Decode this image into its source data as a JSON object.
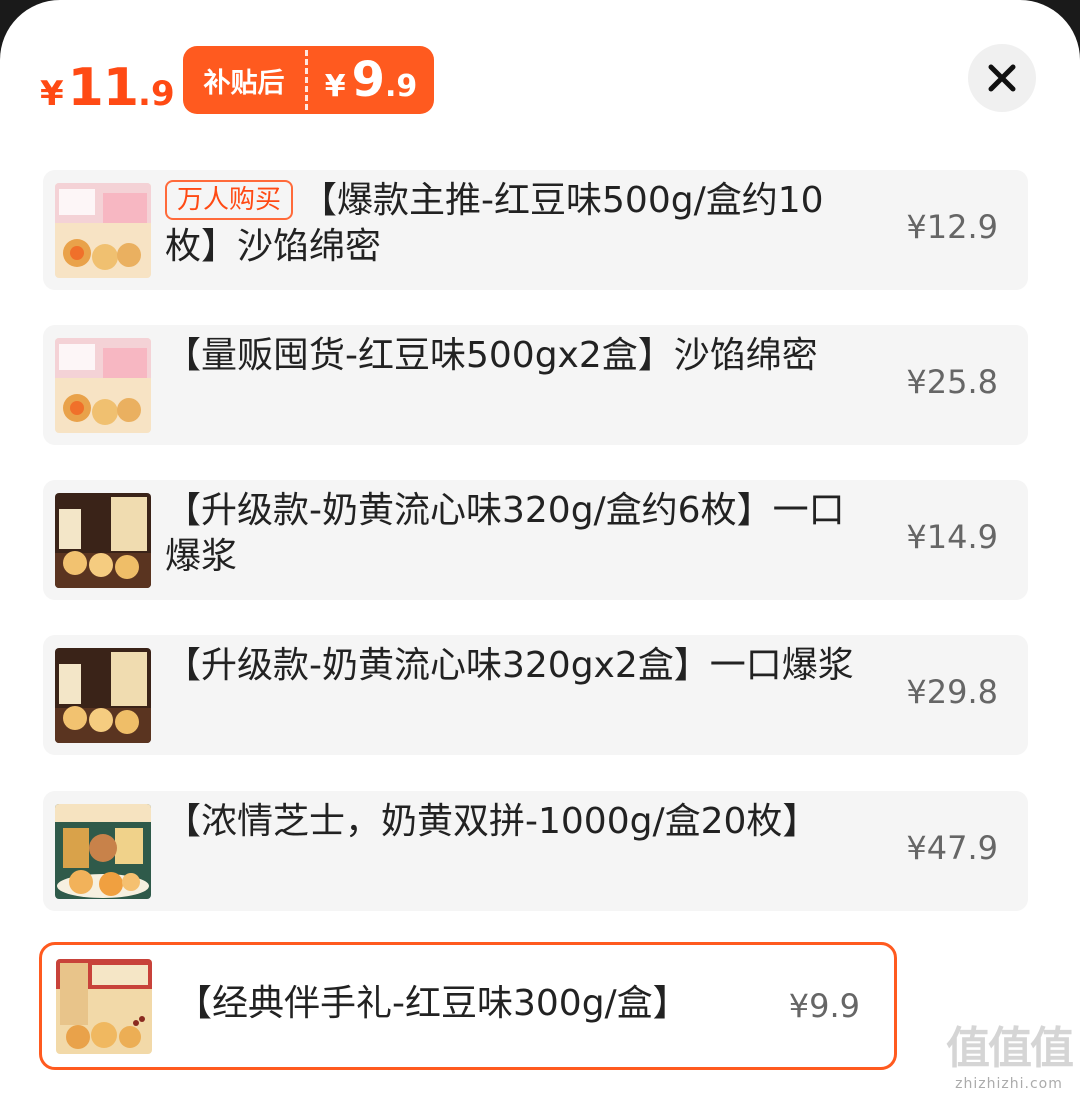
{
  "header": {
    "price_currency": "¥",
    "price_int": "11",
    "price_dec": ".9",
    "subsidy_label": "补贴后",
    "subsidy_currency": "¥",
    "subsidy_int": "9",
    "subsidy_dec": ".9"
  },
  "colors": {
    "accent": "#ff5a1f",
    "price": "#ff4a14",
    "item_bg": "#f5f5f5"
  },
  "close_icon": "close-icon",
  "skus": [
    {
      "badge": "万人购买",
      "name": "【爆款主推-红豆味500g/盒约10枚】沙馅绵密",
      "price": "¥12.9",
      "selected": false
    },
    {
      "badge": "",
      "name": "【量贩囤货-红豆味500gx2盒】沙馅绵密",
      "price": "¥25.8",
      "selected": false
    },
    {
      "badge": "",
      "name": "【升级款-奶黄流心味320g/盒约6枚】一口爆浆",
      "price": "¥14.9",
      "selected": false
    },
    {
      "badge": "",
      "name": "【升级款-奶黄流心味320gx2盒】一口爆浆",
      "price": "¥29.8",
      "selected": false
    },
    {
      "badge": "",
      "name": "【浓情芝士，奶黄双拼-1000g/盒20枚】",
      "price": "¥47.9",
      "selected": false
    },
    {
      "badge": "",
      "name": "【经典伴手礼-红豆味300g/盒】",
      "price": "¥9.9",
      "selected": true
    }
  ],
  "watermark": {
    "logo": "值值值",
    "url": "zhizhizhi.com"
  }
}
